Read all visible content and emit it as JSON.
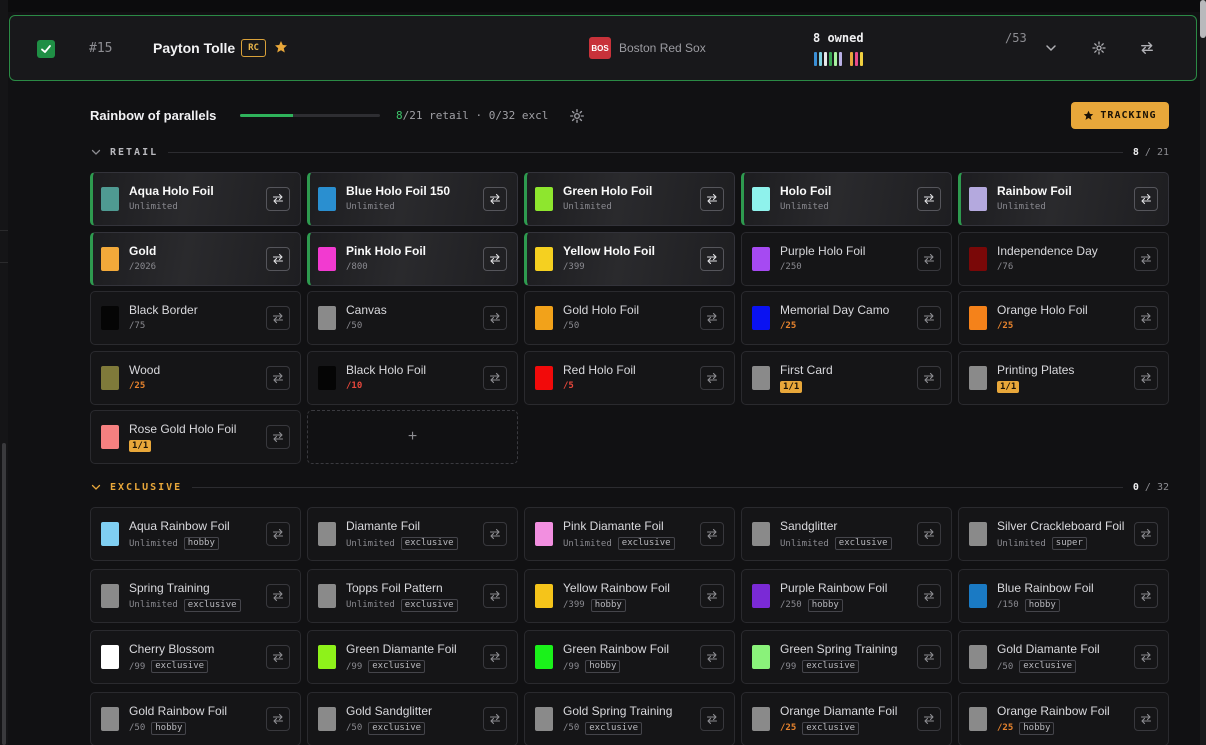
{
  "player": {
    "number": "#15",
    "name": "Payton Tolle",
    "rookie_badge": "RC",
    "team_abbr": "BOS",
    "team_name": "Boston Red Sox",
    "owned_label": "8 owned",
    "total": "/53",
    "owned_bar_colors": [
      "#3a8fd6",
      "#7fd0e0",
      "#e8e8ea",
      "#3aa655",
      "#a7f2a0",
      "#b9b0e6",
      "#e8a73a",
      "#e84a8c",
      "#f0d040"
    ]
  },
  "rainbow": {
    "title": "Rainbow of parallels",
    "progress": 0.38,
    "retail_owned": "8",
    "retail_rest": "/21 retail · 0/32 excl",
    "tracking_label": "TRACKING"
  },
  "sections": {
    "retail": {
      "label": "RETAIL",
      "owned": "8",
      "total": "/ 21"
    },
    "exclusive": {
      "label": "EXCLUSIVE",
      "owned": "0",
      "total": "/ 32"
    }
  },
  "add_label": "+",
  "retail_cards": [
    {
      "name": "Aqua Holo Foil",
      "sub": "Unlimited",
      "color": "#4f9a92",
      "owned": true
    },
    {
      "name": "Blue Holo Foil 150",
      "sub": "Unlimited",
      "color": "#2a8fd0",
      "owned": true
    },
    {
      "name": "Green Holo Foil",
      "sub": "Unlimited",
      "color": "#8ee62e",
      "owned": true
    },
    {
      "name": "Holo Foil",
      "sub": "Unlimited",
      "color": "#8ff2ec",
      "owned": true
    },
    {
      "name": "Rainbow Foil",
      "sub": "Unlimited",
      "color": "#b4a9de",
      "owned": true
    },
    {
      "name": "Gold",
      "sub": "/2026",
      "color": "#f2a93a",
      "owned": true
    },
    {
      "name": "Pink Holo Foil",
      "sub": "/800",
      "color": "#f23ad0",
      "owned": true
    },
    {
      "name": "Yellow Holo Foil",
      "sub": "/399",
      "color": "#f5d020",
      "owned": true
    },
    {
      "name": "Purple Holo Foil",
      "sub": "/250",
      "color": "#a64af2",
      "owned": false
    },
    {
      "name": "Independence Day",
      "sub": "/76",
      "color": "#7a0808",
      "owned": false
    },
    {
      "name": "Black Border",
      "sub": "/75",
      "color": "#050505",
      "owned": false
    },
    {
      "name": "Canvas",
      "sub": "/50",
      "color": "#8a8a8a",
      "owned": false
    },
    {
      "name": "Gold Holo Foil",
      "sub": "/50",
      "color": "#f2a21a",
      "owned": false
    },
    {
      "name": "Memorial Day Camo",
      "sub": "/25",
      "color": "#0a12f2",
      "owned": false,
      "style": "low"
    },
    {
      "name": "Orange Holo Foil",
      "sub": "/25",
      "color": "#f5821a",
      "owned": false,
      "style": "low"
    },
    {
      "name": "Wood",
      "sub": "/25",
      "color": "#7f7a3a",
      "owned": false,
      "style": "low"
    },
    {
      "name": "Black Holo Foil",
      "sub": "/10",
      "color": "#050505",
      "owned": false,
      "style": "red"
    },
    {
      "name": "Red Holo Foil",
      "sub": "/5",
      "color": "#f20a0a",
      "owned": false,
      "style": "red"
    },
    {
      "name": "First Card",
      "sub": "1/1",
      "color": "#8a8a8a",
      "owned": false,
      "style": "oneone"
    },
    {
      "name": "Printing Plates",
      "sub": "1/1",
      "color": "#8a8a8a",
      "owned": false,
      "style": "oneone"
    },
    {
      "name": "Rose Gold Holo Foil",
      "sub": "1/1",
      "color": "#f58080",
      "owned": false,
      "style": "oneone"
    }
  ],
  "exclusive_cards": [
    {
      "name": "Aqua Rainbow Foil",
      "sub": "Unlimited",
      "tag": "hobby",
      "color": "#7fcff2"
    },
    {
      "name": "Diamante Foil",
      "sub": "Unlimited",
      "tag": "exclusive",
      "color": "#8a8a8a"
    },
    {
      "name": "Pink Diamante Foil",
      "sub": "Unlimited",
      "tag": "exclusive",
      "color": "#f28fe0"
    },
    {
      "name": "Sandglitter",
      "sub": "Unlimited",
      "tag": "exclusive",
      "color": "#8a8a8a"
    },
    {
      "name": "Silver Crackleboard Foil",
      "sub": "Unlimited",
      "tag": "super",
      "color": "#8a8a8a"
    },
    {
      "name": "Spring Training",
      "sub": "Unlimited",
      "tag": "exclusive",
      "color": "#8a8a8a"
    },
    {
      "name": "Topps Foil Pattern",
      "sub": "Unlimited",
      "tag": "exclusive",
      "color": "#8a8a8a"
    },
    {
      "name": "Yellow Rainbow Foil",
      "sub": "/399",
      "tag": "hobby",
      "color": "#f5c41a"
    },
    {
      "name": "Purple Rainbow Foil",
      "sub": "/250",
      "tag": "hobby",
      "color": "#7a2ad6"
    },
    {
      "name": "Blue Rainbow Foil",
      "sub": "/150",
      "tag": "hobby",
      "color": "#1a7ac4"
    },
    {
      "name": "Cherry Blossom",
      "sub": "/99",
      "tag": "exclusive",
      "color": "#ffffff"
    },
    {
      "name": "Green Diamante Foil",
      "sub": "/99",
      "tag": "exclusive",
      "color": "#8ef21a"
    },
    {
      "name": "Green Rainbow Foil",
      "sub": "/99",
      "tag": "hobby",
      "color": "#1af21a"
    },
    {
      "name": "Green Spring Training",
      "sub": "/99",
      "tag": "exclusive",
      "color": "#8af27a"
    },
    {
      "name": "Gold Diamante Foil",
      "sub": "/50",
      "tag": "exclusive",
      "color": "#8a8a8a"
    },
    {
      "name": "Gold Rainbow Foil",
      "sub": "/50",
      "tag": "hobby",
      "color": "#8a8a8a"
    },
    {
      "name": "Gold Sandglitter",
      "sub": "/50",
      "tag": "exclusive",
      "color": "#8a8a8a"
    },
    {
      "name": "Gold Spring Training",
      "sub": "/50",
      "tag": "exclusive",
      "color": "#8a8a8a"
    },
    {
      "name": "Orange Diamante Foil",
      "sub": "/25",
      "tag": "exclusive",
      "color": "#8a8a8a",
      "style": "low"
    },
    {
      "name": "Orange Rainbow Foil",
      "sub": "/25",
      "tag": "hobby",
      "color": "#8a8a8a",
      "style": "low"
    }
  ]
}
